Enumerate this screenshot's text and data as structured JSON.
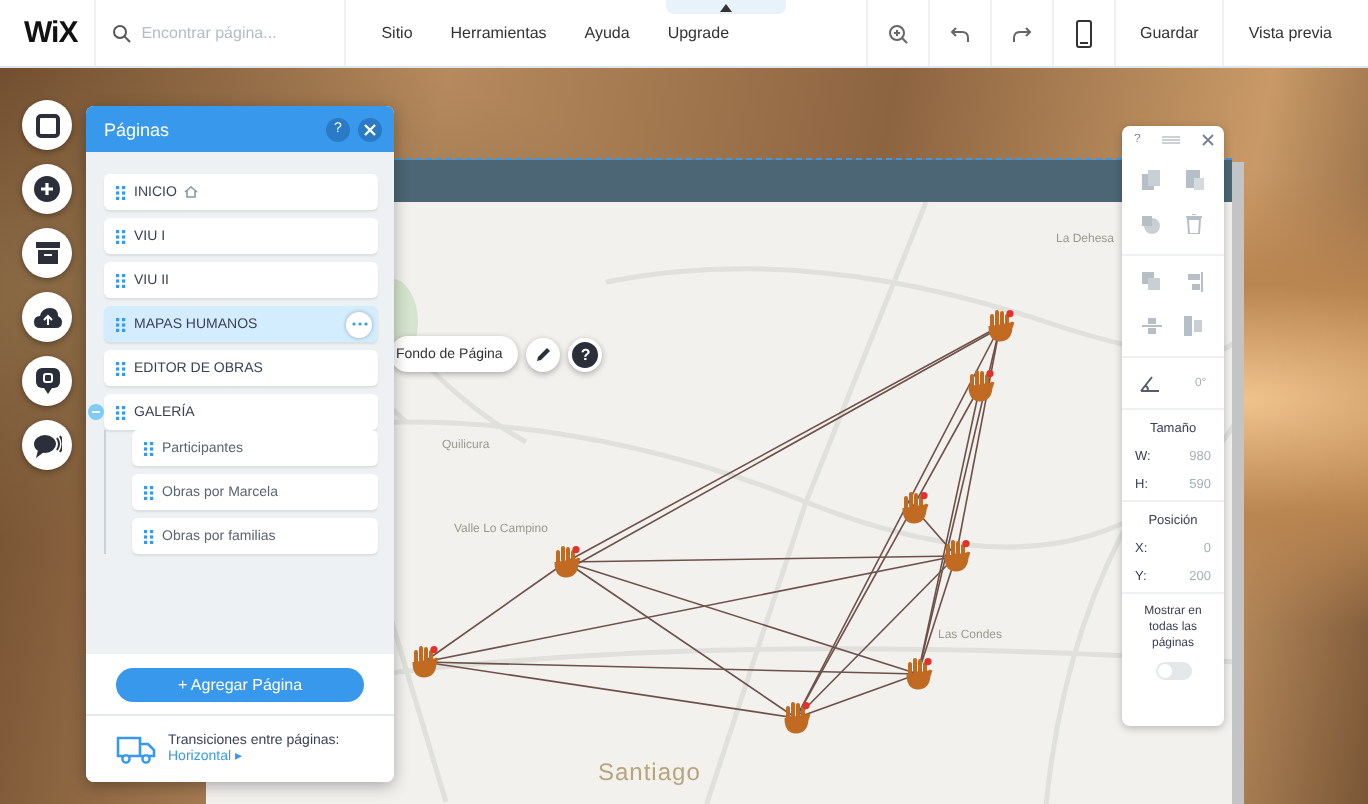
{
  "topbar": {
    "logo": "WiX",
    "search": {
      "placeholder": "Encontrar página..."
    },
    "menu": [
      "Sitio",
      "Herramientas",
      "Ayuda",
      "Upgrade"
    ],
    "save": "Guardar",
    "preview": "Vista previa"
  },
  "pages_panel": {
    "title": "Páginas",
    "help": "?",
    "pages": [
      {
        "label": "INICIO",
        "kind": "home",
        "selected": false
      },
      {
        "label": "VIU I",
        "kind": "page",
        "selected": false
      },
      {
        "label": "VIU II",
        "kind": "page",
        "selected": false
      },
      {
        "label": "MAPAS HUMANOS",
        "kind": "page",
        "selected": true
      },
      {
        "label": "EDITOR DE OBRAS",
        "kind": "page",
        "selected": false
      },
      {
        "label": "GALERÍA",
        "kind": "page",
        "selected": false,
        "expanded": true,
        "children": [
          {
            "label": "Participantes",
            "selected": false
          },
          {
            "label": "Obras por Marcela",
            "selected": false
          },
          {
            "label": "Obras por familias",
            "selected": false
          }
        ]
      }
    ],
    "add_button": "+ Agregar Página",
    "transitions_label": "Transiciones entre páginas:",
    "transitions_value": "Horizontal ▸"
  },
  "background_toolbar": {
    "label": "Fondo de Página",
    "help": "?"
  },
  "map": {
    "labels": [
      "La Dehesa",
      "Quilicura",
      "Valle Lo Campino",
      "Las Condes",
      "Santiago"
    ]
  },
  "right_panel": {
    "help": "?",
    "rotation": "0°",
    "size_title": "Tamaño",
    "size": [
      {
        "label": "W:",
        "value": "980"
      },
      {
        "label": "H:",
        "value": "590"
      }
    ],
    "position_title": "Posición",
    "position": [
      {
        "label": "X:",
        "value": "0"
      },
      {
        "label": "Y:",
        "value": "200"
      }
    ],
    "show_all_label": "Mostrar en todas las páginas",
    "show_all_on": false
  }
}
